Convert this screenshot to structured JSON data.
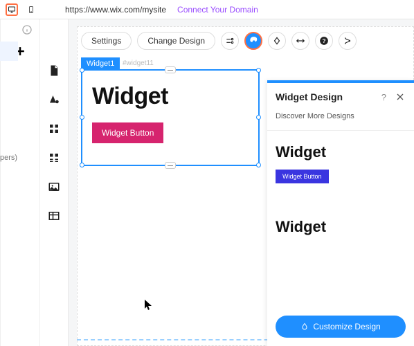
{
  "topbar": {
    "url": "https://www.wix.com/mysite",
    "connect": "Connect Your Domain"
  },
  "members_clip": "pers)",
  "float_toolbar": {
    "settings": "Settings",
    "change_design": "Change Design"
  },
  "selection": {
    "label": "Widget1",
    "element_id": "#widget11",
    "title": "Widget",
    "button": "Widget Button"
  },
  "panel": {
    "title": "Widget Design",
    "help": "?",
    "discover": "Discover More Designs",
    "designs": [
      {
        "title": "Widget",
        "button": "Widget Button",
        "button_color": "#3a35e0"
      },
      {
        "title": "Widget",
        "button": "",
        "button_color": "#ffd6e6"
      }
    ],
    "customize": "Customize Design"
  }
}
